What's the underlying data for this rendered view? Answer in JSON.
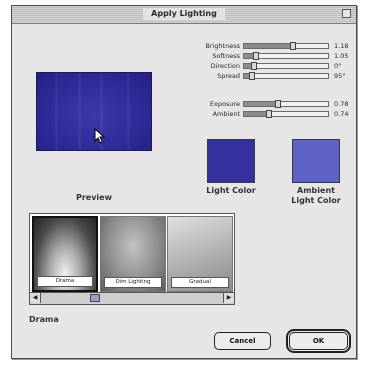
{
  "window": {
    "title": "Apply Lighting"
  },
  "sliders_group1": [
    {
      "label": "Brightness",
      "value": "1.18",
      "fraction": 0.58
    },
    {
      "label": "Softness",
      "value": "1.05",
      "fraction": 0.14
    },
    {
      "label": "Direction",
      "value": "0°",
      "fraction": 0.12
    },
    {
      "label": "Spread",
      "value": "95°",
      "fraction": 0.1
    }
  ],
  "sliders_group2": [
    {
      "label": "Exposure",
      "value": "0.78",
      "fraction": 0.4
    },
    {
      "label": "Ambient",
      "value": "0.74",
      "fraction": 0.3
    }
  ],
  "preview": {
    "label": "Preview",
    "color": "#2e2c9a"
  },
  "swatches": {
    "light": {
      "label": "Light Color",
      "color": "#3430a0"
    },
    "ambient": {
      "label_line1": "Ambient",
      "label_line2": "Light Color",
      "color": "#5d62c4"
    }
  },
  "styles": {
    "items": [
      {
        "caption": "Drama"
      },
      {
        "caption": "Dim Lighting"
      },
      {
        "caption": "Gradual"
      }
    ],
    "selected_name": "Drama"
  },
  "buttons": {
    "cancel": "Cancel",
    "ok": "OK"
  }
}
